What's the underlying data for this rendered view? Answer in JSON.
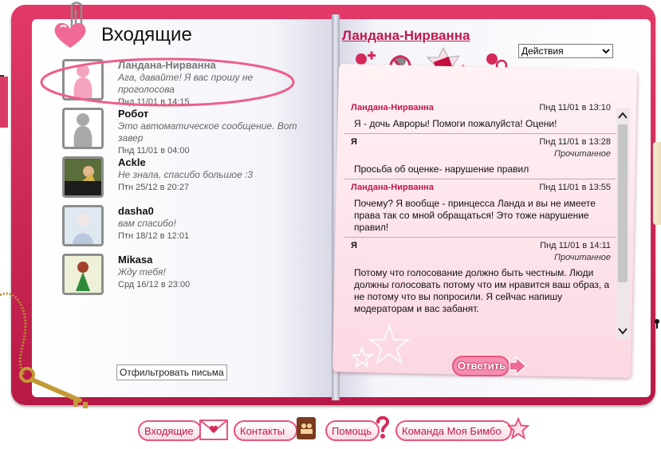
{
  "inbox": {
    "title": "Входящие",
    "filter_label": "Отфильтровать письма",
    "messages": [
      {
        "name": "Ландана-Нирванна",
        "preview": "Ага, давайте! Я вас прошу не проголосова",
        "date": "Пнд 11/01 в 14:15",
        "avatar": "pink-silhouette"
      },
      {
        "name": "Робот",
        "preview": "Это автоматическое сообщение. Вот завер",
        "date": "Пнд 11/01 в 04:00",
        "avatar": "gray-silhouette"
      },
      {
        "name": "Ackle",
        "preview": "Не знала, спасибо большое :3",
        "date": "Птн 25/12 в 20:27",
        "avatar": "photo"
      },
      {
        "name": "dasha0",
        "preview": "вам спасибо!",
        "date": "Птн 18/12 в 12:01",
        "avatar": "photo"
      },
      {
        "name": "Mikasa",
        "preview": "Жду тебя!",
        "date": "Срд 16/12 в 23:00",
        "avatar": "photo"
      }
    ]
  },
  "conversation": {
    "partner": "Ландана-Нирванна",
    "actions_label": "Действия",
    "toolbar_icons": [
      "add-friend-icon",
      "block-user-icon",
      "gift-icon",
      "search-user-icon"
    ],
    "messages": [
      {
        "sender": "Ландана-Нирванна",
        "time": "Пнд 11/01 в 13:10",
        "status": "",
        "text": "Я - дочь Авроры! Помоги пожалуйста! Оцени!"
      },
      {
        "sender": "Я",
        "time": "Пнд 11/01 в 13:28",
        "status": "Прочитанное",
        "text": "Просьба об оценке- нарушение правил"
      },
      {
        "sender": "Ландана-Нирванна",
        "time": "Пнд 11/01 в 13:55",
        "status": "",
        "text": "Почему? Я вообще - принцесса Ланда и вы не имеете права так со мной обращаться! Это тоже нарушение правил!"
      },
      {
        "sender": "Я",
        "time": "Пнд 11/01 в 14:11",
        "status": "Прочитанное",
        "text": "Потому что голосование должно быть честным. Люди должны голосовать потому что им нравится ваш образ, а не потому что вы попросили. Я сейчас напишу модераторам и вас забанят."
      }
    ],
    "reply_label": "Ответить"
  },
  "nav": {
    "inbox": "Входящие",
    "contacts": "Контакты",
    "help": "Помощь",
    "team": "Команда Моя Бимбо"
  },
  "colors": {
    "accent": "#c0184e",
    "book": "#d42a5a",
    "pill_border": "#e8557d"
  }
}
